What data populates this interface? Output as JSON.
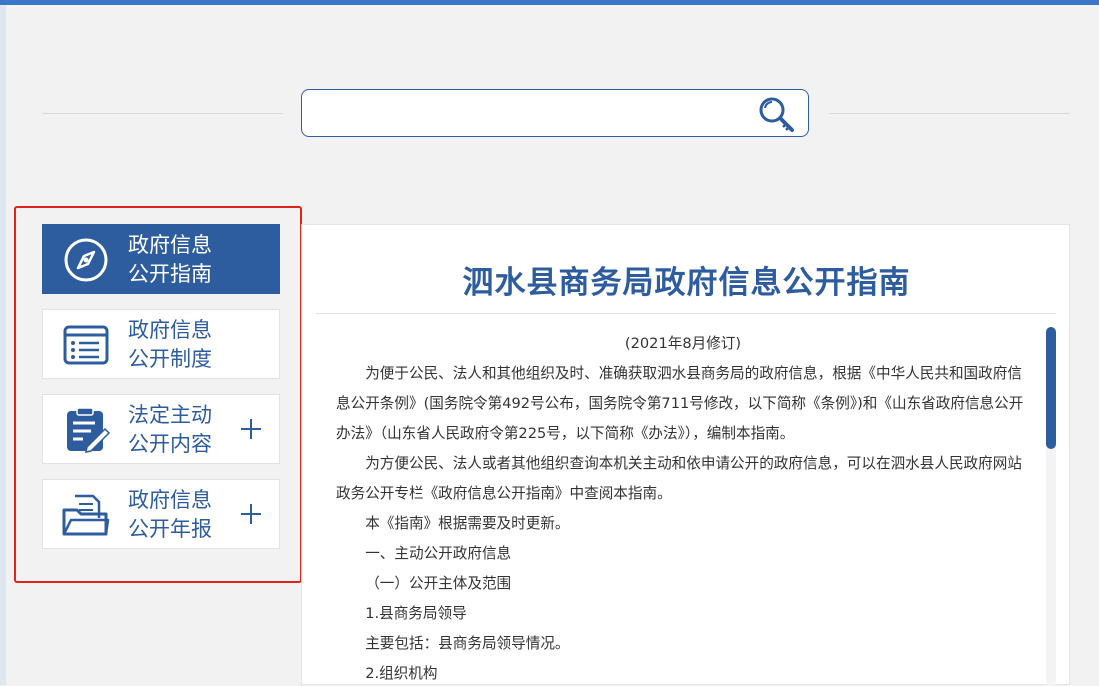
{
  "search": {
    "value": "",
    "placeholder": ""
  },
  "nav": {
    "items": [
      {
        "label": "政府信息\n公开指南",
        "icon": "compass-icon",
        "active": true,
        "expandable": false
      },
      {
        "label": "政府信息\n公开制度",
        "icon": "list-document-icon",
        "active": false,
        "expandable": false
      },
      {
        "label": "法定主动\n公开内容",
        "icon": "clipboard-edit-icon",
        "active": false,
        "expandable": true,
        "expand_symbol": "+"
      },
      {
        "label": "政府信息\n公开年报",
        "icon": "folder-document-icon",
        "active": false,
        "expandable": true,
        "expand_symbol": "+"
      }
    ]
  },
  "main": {
    "title": "泗水县商务局政府信息公开指南",
    "revision": "(2021年8月修订)",
    "paragraphs": [
      "为便于公民、法人和其他组织及时、准确获取泗水县商务局的政府信息，根据《中华人民共和国政府信息公开条例》(国务院令第492号公布，国务院令第711号修改，以下简称《条例》)和《山东省政府信息公开办法》（山东省人民政府令第225号，以下简称《办法》），编制本指南。",
      "为方便公民、法人或者其他组织查询本机关主动和依申请公开的政府信息，可以在泗水县人民政府网站政务公开专栏《政府信息公开指南》中查阅本指南。",
      "本《指南》根据需要及时更新。",
      "一、主动公开政府信息",
      "（一）公开主体及范围",
      "1.县商务局领导",
      "主要包括：县商务局领导情况。",
      "2.组织机构"
    ]
  },
  "colors": {
    "accent": "#2e5d9f",
    "highlight_frame": "#e0241c",
    "top_bar": "#3b77c9"
  }
}
